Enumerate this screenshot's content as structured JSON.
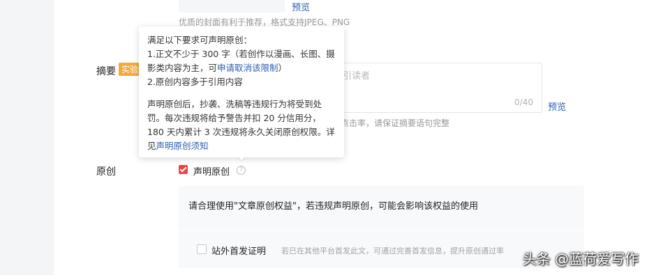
{
  "cover": {
    "preview_label": "预览",
    "hint": "优质的封面有利于推荐，格式支持JPEG、PNG"
  },
  "summary": {
    "label": "摘要",
    "badge": "实验",
    "placeholder": "吸引读者",
    "count": "0/40",
    "preview_label": "预览",
    "hint": "点击率，请保证摘要语句完整"
  },
  "original": {
    "label": "原创",
    "checkbox_label": "声明原创",
    "checked": true,
    "help_icon": "?",
    "rights_text": "请合理使用\"文章原创权益\"，若违规声明原创，可能会影响该权益的使用",
    "first_publish_label": "站外首发证明",
    "first_publish_desc": "若已在其他平台首发此文，可通过完善首发信息，提升原创通过率"
  },
  "tooltip": {
    "heading": "满足以下要求可声明原创：",
    "req1_prefix": "1.正文不少于 300 字（若创作以漫画、长图、摄影类内容为主，可",
    "req1_link": "申请取消该限制",
    "req1_suffix": "）",
    "req2": "2.原创内容多于引用内容",
    "penalty": "声明原创后，抄袭、洗稿等违规行为将受到处罚。每次违规将给予警告并扣 20 分信用分，180 天内累计 3 次违规将永久关闭原创权限。详见",
    "penalty_link": "声明原创须知"
  },
  "watermark": "头条 @蓝荷爱写作",
  "colors": {
    "accent_red": "#f04142",
    "link_blue": "#2a5db0",
    "badge_orange": "#f4a93b"
  }
}
